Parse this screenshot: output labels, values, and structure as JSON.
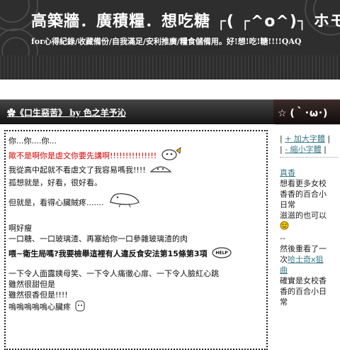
{
  "header": {
    "title": "高築牆．廣積糧．想吃糖 ┌( ┌^o^)┐ ホモォ",
    "subtitle": "for心得紀錄/收藏備份/自我滿足/安利推廣/糧食儲備用。好!想!吃!糖!!!!QAQ"
  },
  "post": {
    "title": "✿《口生惡苦》 by 色之羊予沁",
    "lines": [
      "你...你....你...",
      "歟不是啊你是虐文你要先講啊!!!!!!!!!!!!!!!",
      "我從高中起就不看虐文了我容易嗎我!!!!",
      "孤想就是，好看，很好看。",
      "但就是，看得心臟賊疼.......",
      "啊好瘦",
      "一口糖、一口玻璃渣、再塞給你一口參雜玻璃渣的肉",
      "喂~衛生局嗎?我要檢舉這裡有人違反食安法第15條第3項",
      "一下令人面露姨母笑、一下令人痛徹心扉、一下令人臉紅心跳",
      "雖然很甜但是",
      "雖然很香但是!!!!",
      "嗚嗚嗚嗚嗚心臟疼"
    ],
    "help_sticker": "HELP"
  },
  "sidebar": {
    "title": "☆ (｀･ω･)",
    "font_up": "+ 加大字體",
    "font_down": "- 縮小字體",
    "link1": "真香",
    "text1a": "想看更多女校",
    "text1b": "香香的百合小",
    "text1c": "日常",
    "text1d": "滋滋的也可以",
    "sep_text": "--",
    "text2a": "然後重看了一",
    "text2b": "次",
    "link2a": "哈士奇x狙",
    "link2b": "曲",
    "text3a": "確實是女校香",
    "text3b": "香的百合小日",
    "text3c": "常"
  },
  "colors": {
    "banner_bg": "#2e2e2e",
    "title_bar": "#141414",
    "alert_red": "#d40000",
    "link": "#3a7a8a"
  }
}
